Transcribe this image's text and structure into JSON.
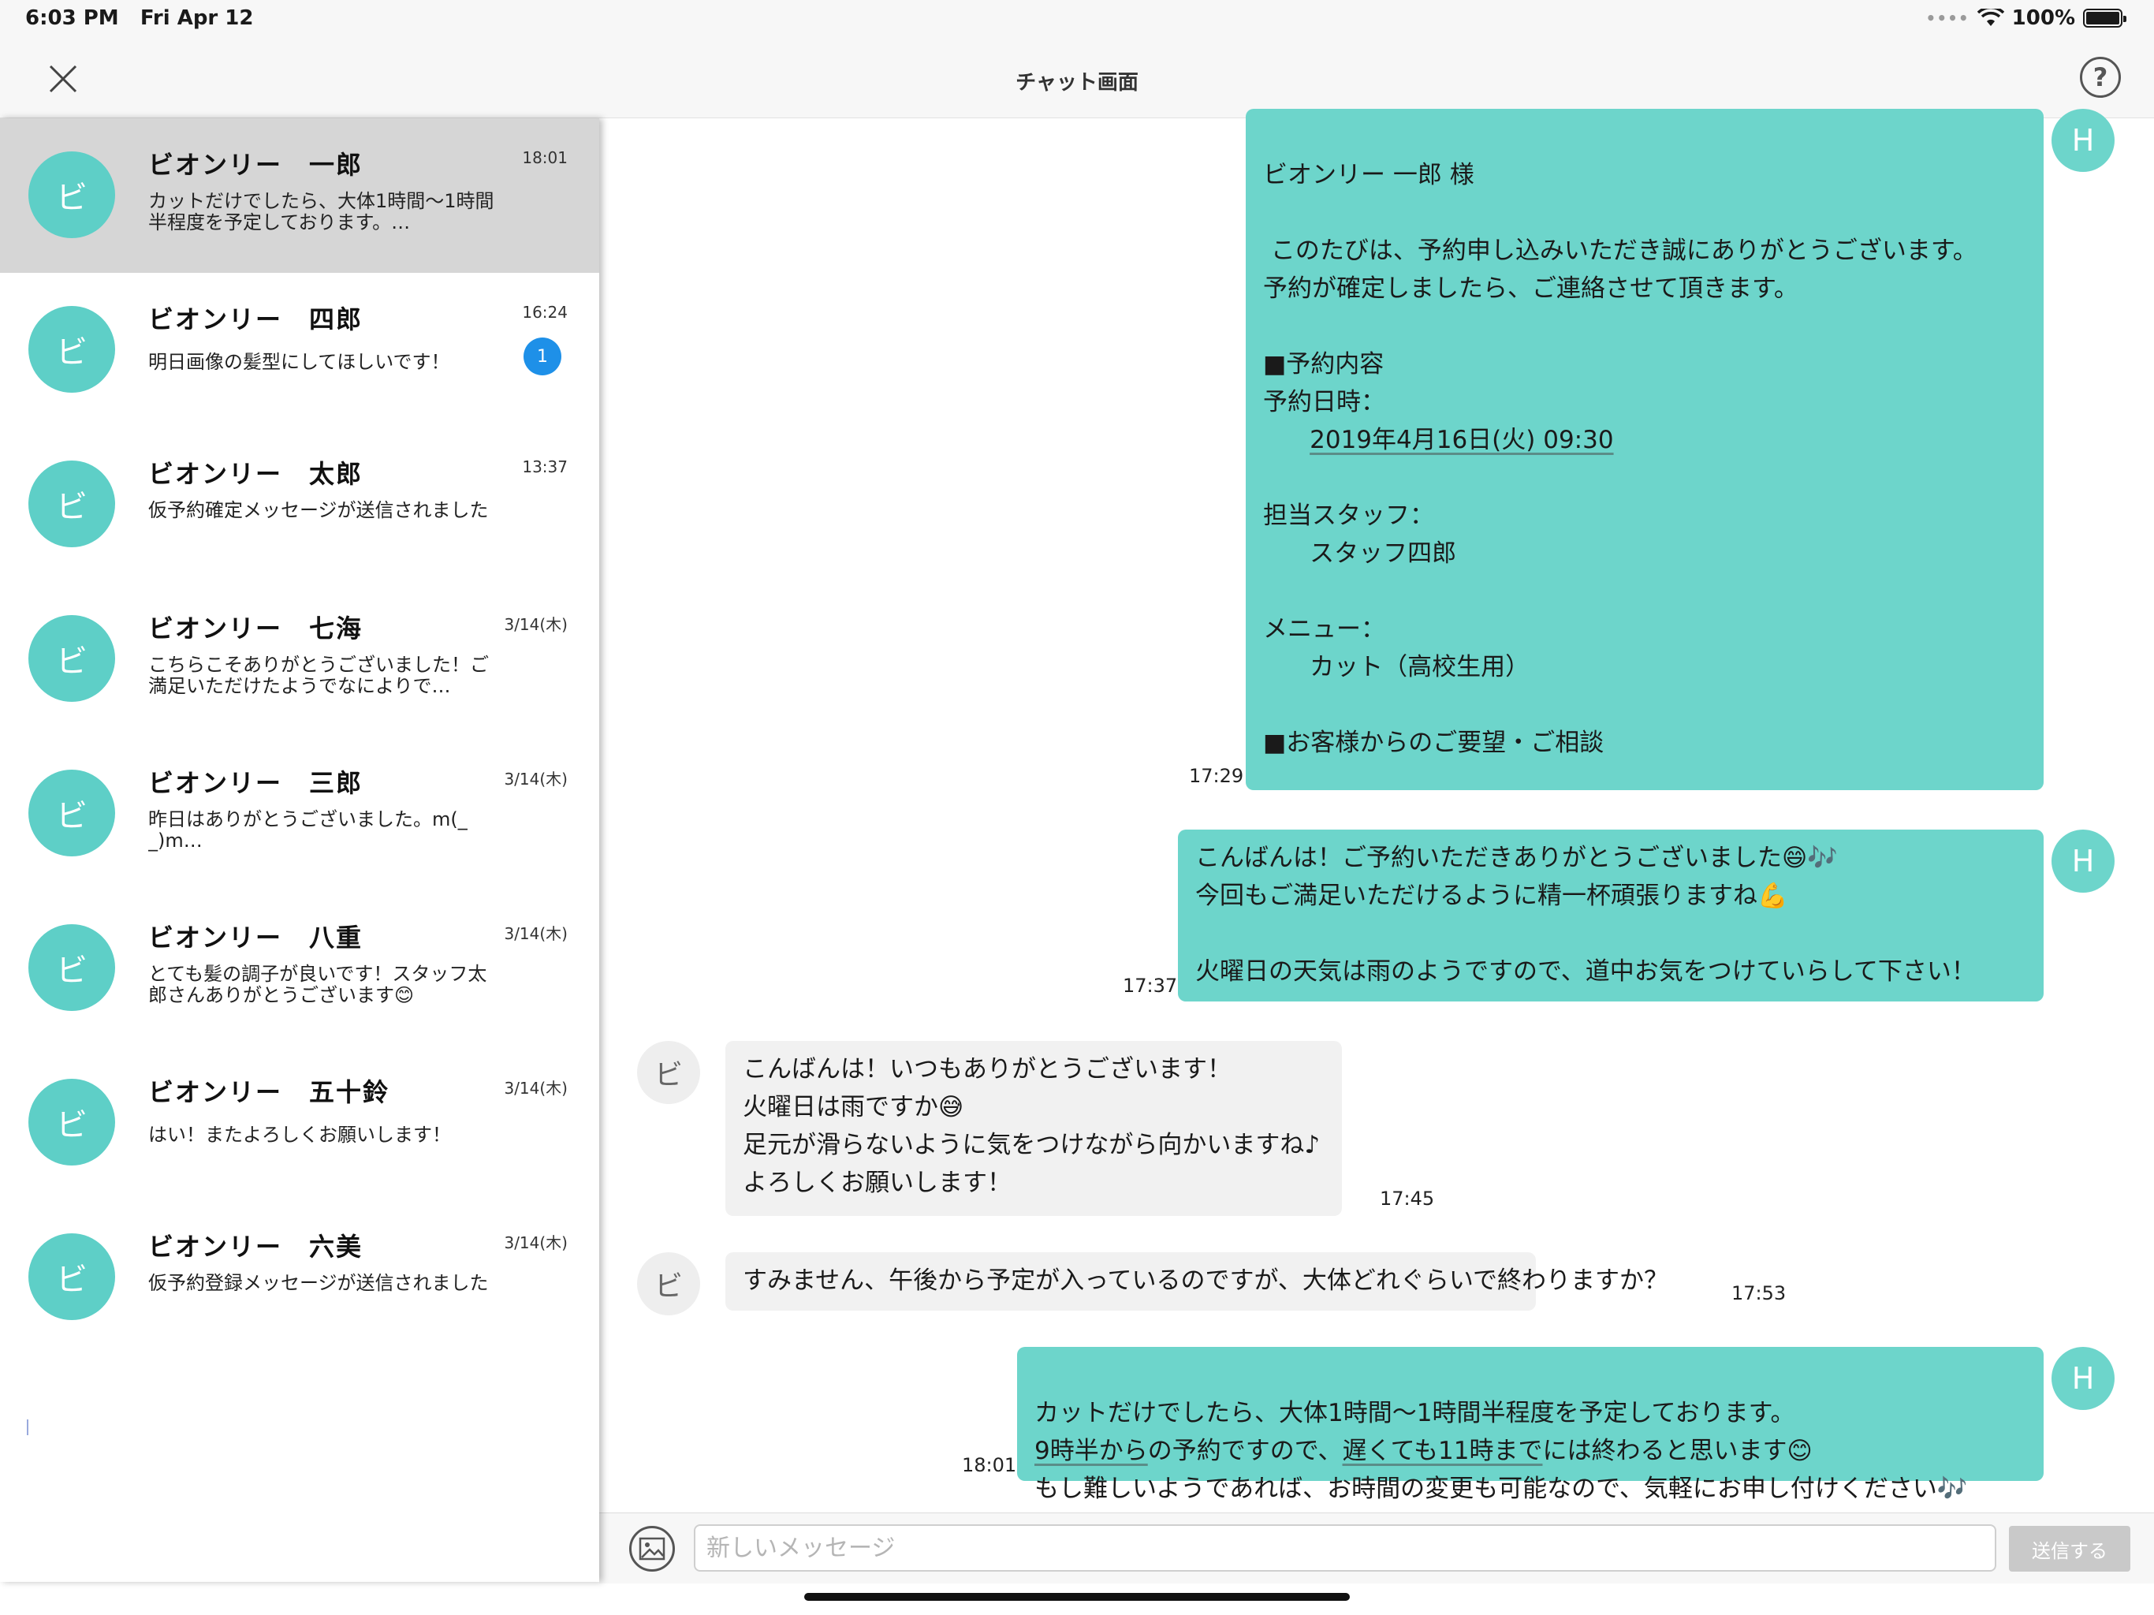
{
  "status_bar": {
    "time": "6:03 PM",
    "date": "Fri Apr 12",
    "dots": "••••",
    "battery": "100%"
  },
  "nav": {
    "title": "チャット画面",
    "help": "?"
  },
  "conversations": [
    {
      "avatar": "ビ",
      "name": "ビオンリー　一郎",
      "time": "18:01",
      "preview": "カットだけでしたら、大体1時間〜1時間半程度を予定しております。…",
      "active": true
    },
    {
      "avatar": "ビ",
      "name": "ビオンリー　四郎",
      "time": "16:24",
      "preview": "明日画像の髪型にしてほしいです！",
      "badge": "1"
    },
    {
      "avatar": "ビ",
      "name": "ビオンリー　太郎",
      "time": "13:37",
      "preview": "仮予約確定メッセージが送信されました"
    },
    {
      "avatar": "ビ",
      "name": "ビオンリー　七海",
      "time": "3/14(木)",
      "preview": "こちらこそありがとうございました！ご満足いただけたようでなによりで…"
    },
    {
      "avatar": "ビ",
      "name": "ビオンリー　三郎",
      "time": "3/14(木)",
      "preview": "昨日はありがとうございました。m(_ _)m…"
    },
    {
      "avatar": "ビ",
      "name": "ビオンリー　八重",
      "time": "3/14(木)",
      "preview": "とても髪の調子が良いです！スタッフ太郎さんありがとうございます😊"
    },
    {
      "avatar": "ビ",
      "name": "ビオンリー　五十鈴",
      "time": "3/14(木)",
      "preview": "はい！またよろしくお願いします！"
    },
    {
      "avatar": "ビ",
      "name": "ビオンリー　六美",
      "time": "3/14(木)",
      "preview": "仮予約登録メッセージが送信されました"
    }
  ],
  "messages": {
    "m1": {
      "time": "17:29",
      "avatar": "H",
      "l1": "ビオンリー 一郎 様",
      "l2": " このたびは、予約申し込みいただき誠にありがとうございます。",
      "l3": "予約が確定しましたら、ご連絡させて頂きます。",
      "l4": "■予約内容",
      "l5": "予約日時：",
      "l6": "2019年4月16日(火) 09:30",
      "l7": "担当スタッフ：",
      "l8": "スタッフ四郎",
      "l9": "メニュー：",
      "l10": "カット（高校生用）",
      "l11": "■お客様からのご要望・ご相談"
    },
    "m2": {
      "time": "17:37",
      "avatar": "H",
      "text": "こんばんは！ご予約いただきありがとうございました😄🎶\n今回もご満足いただけるように精一杯頑張りますね💪\n\n火曜日の天気は雨のようですので、道中お気をつけていらして下さい！"
    },
    "m3": {
      "time": "17:45",
      "avatar": "ビ",
      "text": "こんばんは！いつもありがとうございます！\n火曜日は雨ですか😅\n足元が滑らないように気をつけながら向かいますね♪\nよろしくお願いします！"
    },
    "m4": {
      "time": "17:53",
      "avatar": "ビ",
      "text": "すみません、午後から予定が入っているのですが、大体どれぐらいで終わりますか？"
    },
    "m5": {
      "time": "18:01",
      "avatar": "H",
      "l1": "カットだけでしたら、大体1時間〜1時間半程度を予定しております。",
      "l2a": "9時半から",
      "l2b": "の予約ですので、",
      "l2c": "遅くても11時まで",
      "l2d": "には終わると思います😊",
      "l3": "もし難しいようであれば、お時間の変更も可能なので、気軽にお申し付けください🎶"
    }
  },
  "input": {
    "placeholder": "新しいメッセージ",
    "send_label": "送信する"
  },
  "colors": {
    "accent": "#6dd5cb",
    "badge": "#1e90e8",
    "active_row": "#d6d6d6",
    "incoming": "#f1f1f1"
  }
}
